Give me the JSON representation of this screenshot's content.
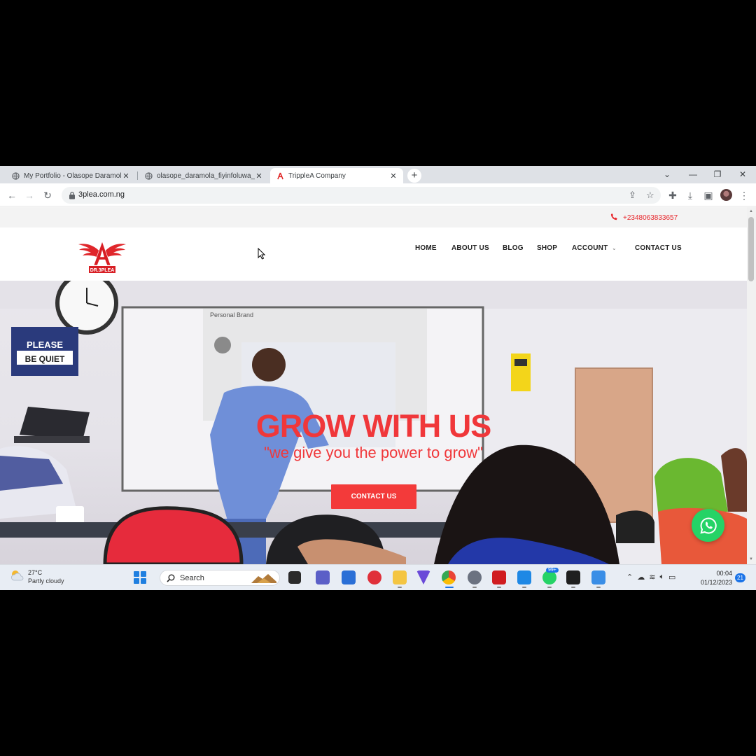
{
  "browser": {
    "tabs": [
      {
        "title": "My Portfolio - Olasope Daramola",
        "active": false
      },
      {
        "title": "olasope_daramola_fiyinfoluwa_c",
        "active": false
      },
      {
        "title": "TrippleA Company",
        "active": true
      }
    ],
    "new_tab_label": "+",
    "url": "3plea.com.ng"
  },
  "site": {
    "phone": "+2348063833657",
    "logo_text": "DR.3PLEA",
    "nav": [
      "HOME",
      "ABOUT US",
      "BLOG",
      "SHOP",
      "ACCOUNT",
      "CONTACT US"
    ],
    "hero": {
      "title": "GROW WITH US",
      "subtitle": "\"we give you the power to grow\"",
      "cta": "CONTACT US",
      "photo_signs": {
        "sign_line1": "PLEASE",
        "sign_line2": "BE QUIET",
        "slide_label": "Personal Brand"
      }
    },
    "accent_color": "#f0373a"
  },
  "taskbar": {
    "weather_temp": "27°C",
    "weather_cond": "Partly cloudy",
    "search_placeholder": "Search",
    "whatsapp_badge": "99+",
    "time": "00:04",
    "date": "01/12/2023",
    "notifications": "21"
  }
}
